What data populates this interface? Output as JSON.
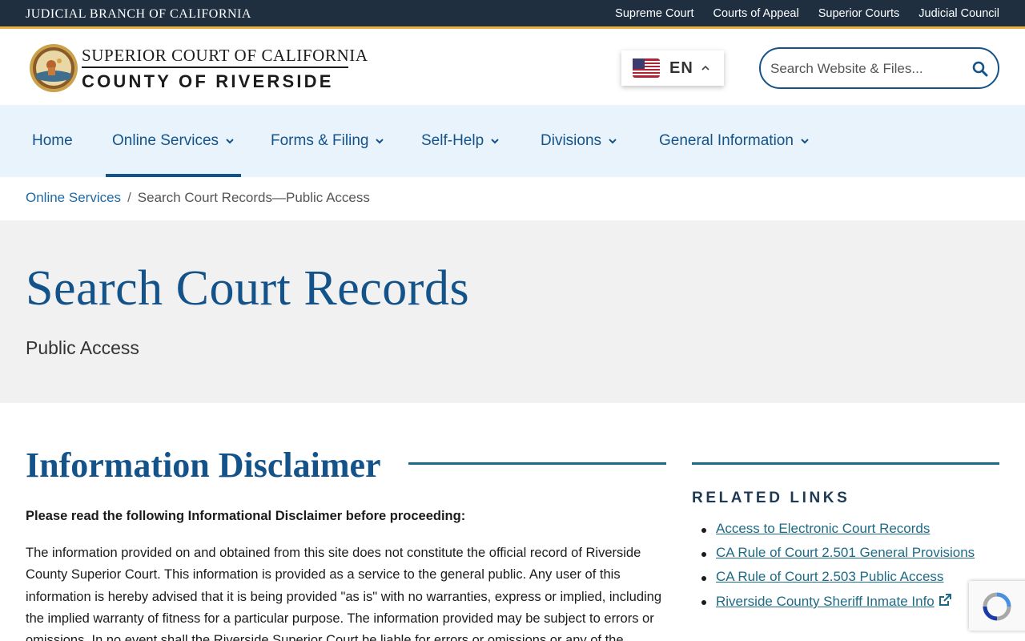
{
  "utility": {
    "brand": "JUDICIAL BRANCH OF CALIFORNIA",
    "links": [
      "Supreme Court",
      "Courts of Appeal",
      "Superior Courts",
      "Judicial Council"
    ]
  },
  "header": {
    "logo_line1": "SUPERIOR COURT OF CALIFORNIA",
    "logo_line2": "COUNTY OF RIVERSIDE",
    "language": "EN",
    "search_placeholder": "Search Website & Files..."
  },
  "nav": {
    "items": [
      {
        "label": "Home",
        "dropdown": false
      },
      {
        "label": "Online Services",
        "dropdown": true,
        "active": true
      },
      {
        "label": "Forms & Filing",
        "dropdown": true
      },
      {
        "label": "Self-Help",
        "dropdown": true
      },
      {
        "label": "Divisions",
        "dropdown": true
      },
      {
        "label": "General Information",
        "dropdown": true
      }
    ]
  },
  "breadcrumb": {
    "parent": "Online Services",
    "separator": "/",
    "current": "Search Court Records—Public Access"
  },
  "hero": {
    "title": "Search Court Records",
    "subtitle": "Public Access"
  },
  "main": {
    "section_title": "Information Disclaimer",
    "lead": "Please read the following Informational Disclaimer before proceeding:",
    "body": "The information provided on and obtained from this site does not constitute the official record of Riverside County Superior Court. This information is provided as a service to the general public. Any user of this information is hereby advised that it is being provided \"as is\" with no warranties, express or implied, including the implied warranty of fitness for a particular purpose. The information provided may be subject to errors or omissions. In no event shall the Riverside Superior Court be liable for errors or omissions or any of the"
  },
  "related": {
    "title": "RELATED LINKS",
    "links": [
      "Access to Electronic Court Records",
      "CA Rule of Court 2.501 General Provisions",
      "CA Rule of Court 2.503 Public Access",
      "Riverside County Sheriff Inmate Info"
    ]
  },
  "colors": {
    "top_bar": "#1f2f40",
    "accent_gold": "#e8b23f",
    "primary_blue": "#14538a",
    "nav_bg": "#e9f3fb",
    "hero_bg": "#f1f1f1",
    "link_teal": "#1d6a85"
  },
  "icons": [
    "court-seal",
    "us-flag-icon",
    "chevron-up-icon",
    "search-icon",
    "chevron-down-icon",
    "external-link-icon",
    "recaptcha-icon"
  ]
}
